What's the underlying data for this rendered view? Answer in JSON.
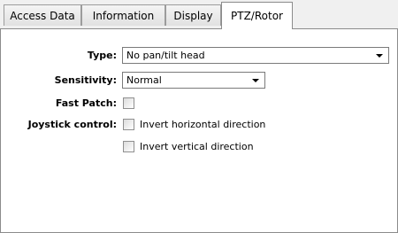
{
  "tabs": [
    {
      "label": "Access Data"
    },
    {
      "label": "Information"
    },
    {
      "label": "Display"
    },
    {
      "label": "PTZ/Rotor",
      "selected": true
    }
  ],
  "form": {
    "type": {
      "label": "Type:",
      "value": "No pan/tilt head"
    },
    "sensitivity": {
      "label": "Sensitivity:",
      "value": "Normal"
    },
    "fast_patch": {
      "label": "Fast Patch:",
      "checked": false
    },
    "joystick": {
      "label": "Joystick control:",
      "invert_horizontal": {
        "label": "Invert horizontal direction",
        "checked": false
      },
      "invert_vertical": {
        "label": "Invert vertical direction",
        "checked": false
      }
    }
  }
}
